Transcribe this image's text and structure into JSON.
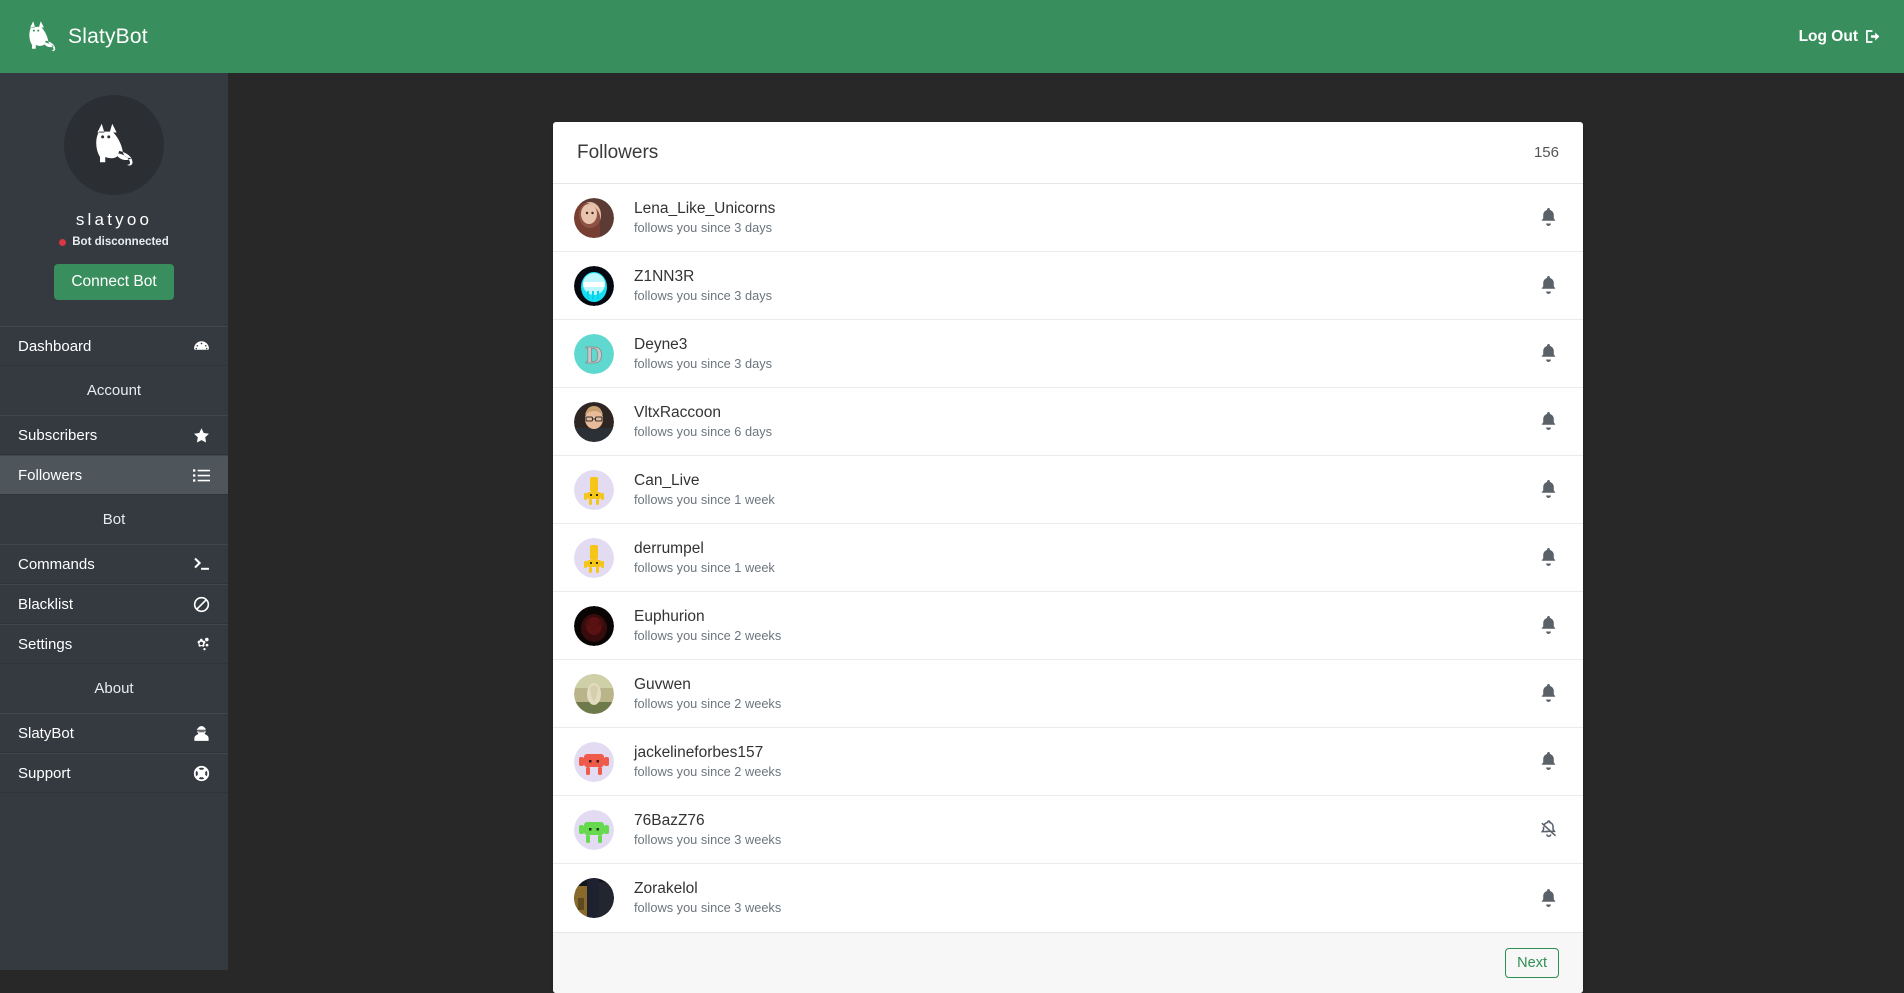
{
  "topbar": {
    "brand": "SlatyBot",
    "brand_icon": "cat-logo-icon",
    "logout_label": "Log Out",
    "logout_icon": "sign-out-icon",
    "background": "#388e5c"
  },
  "sidebar": {
    "profile": {
      "avatar_icon": "cat-avatar-icon",
      "name": "slatyoo",
      "status": "Bot disconnected",
      "status_color": "#dc3545",
      "connect_label": "Connect Bot"
    },
    "items": [
      {
        "label": "Dashboard",
        "icon": "tachometer-icon",
        "active": false
      },
      {
        "label": "Subscribers",
        "icon": "star-icon",
        "active": false
      },
      {
        "label": "Followers",
        "icon": "list-icon",
        "active": true
      },
      {
        "label": "Commands",
        "icon": "terminal-icon",
        "active": false
      },
      {
        "label": "Blacklist",
        "icon": "ban-icon",
        "active": false
      },
      {
        "label": "SlatyBot",
        "icon": "user-secret-icon",
        "active": false
      },
      {
        "label": "Support",
        "icon": "life-ring-icon",
        "active": false
      },
      {
        "label": "Settings",
        "icon": "cogs-icon",
        "active": false
      }
    ],
    "groups": {
      "account": "Account",
      "bot": "Bot",
      "about": "About"
    }
  },
  "card": {
    "title": "Followers",
    "count": "156",
    "next_label": "Next",
    "accent": "#2f8e53",
    "rows": [
      {
        "name": "Lena_Like_Unicorns",
        "since": "follows you since 3 days",
        "bell": "bell-icon",
        "avatar": "photo-woman-brown"
      },
      {
        "name": "Z1NN3R",
        "since": "follows you since 3 days",
        "bell": "bell-icon",
        "avatar": "photo-neon-cyan"
      },
      {
        "name": "Deyne3",
        "since": "follows you since 3 days",
        "bell": "bell-icon",
        "avatar": "letter-d-teal"
      },
      {
        "name": "VltxRaccoon",
        "since": "follows you since 6 days",
        "bell": "bell-icon",
        "avatar": "photo-man-glasses"
      },
      {
        "name": "Can_Live",
        "since": "follows you since 1 week",
        "bell": "bell-icon",
        "avatar": "robot-yellow"
      },
      {
        "name": "derrumpel",
        "since": "follows you since 1 week",
        "bell": "bell-icon",
        "avatar": "robot-yellow"
      },
      {
        "name": "Euphurion",
        "since": "follows you since 2 weeks",
        "bell": "bell-icon",
        "avatar": "photo-dark-red"
      },
      {
        "name": "Guvwen",
        "since": "follows you since 2 weeks",
        "bell": "bell-icon",
        "avatar": "photo-outdoor-green"
      },
      {
        "name": "jackelineforbes157",
        "since": "follows you since 2 weeks",
        "bell": "bell-icon",
        "avatar": "robot-red"
      },
      {
        "name": "76BazZ76",
        "since": "follows you since 3 weeks",
        "bell": "bell-slash-icon",
        "avatar": "robot-green"
      },
      {
        "name": "Zorakelol",
        "since": "follows you since 3 weeks",
        "bell": "bell-icon",
        "avatar": "photo-dark-gold"
      }
    ]
  }
}
